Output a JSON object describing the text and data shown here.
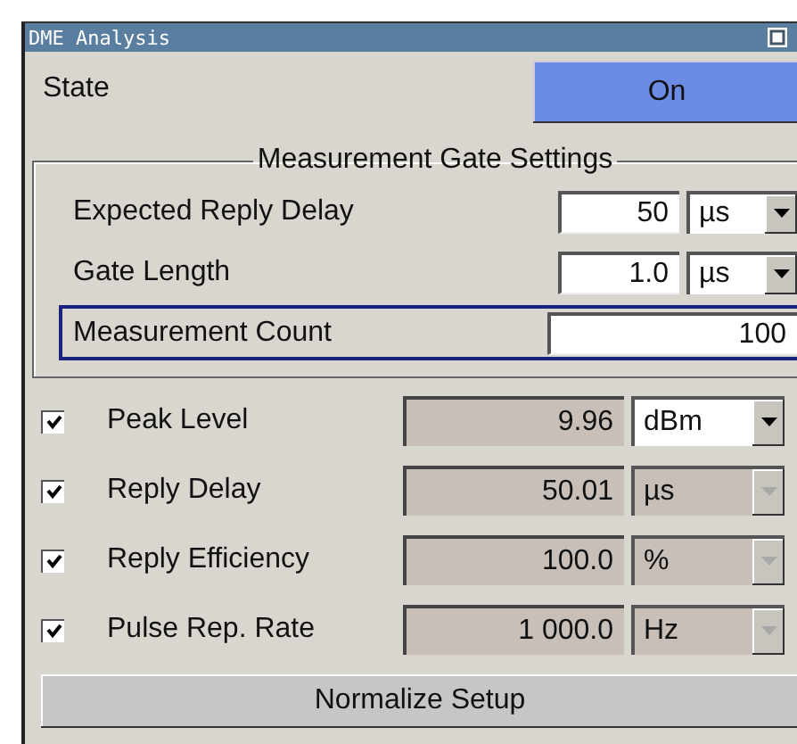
{
  "window": {
    "title": "DME Analysis"
  },
  "state": {
    "label": "State",
    "value": "On",
    "on": true
  },
  "gate": {
    "title": "Measurement Gate Settings",
    "rows": [
      {
        "label": "Expected Reply Delay",
        "value": "50",
        "unit": "µs",
        "focused": false
      },
      {
        "label": "Gate Length",
        "value": "1.0",
        "unit": "µs",
        "focused": false
      },
      {
        "label": "Measurement Count",
        "value": "100",
        "focused": true
      }
    ]
  },
  "measurements": [
    {
      "label": "Peak Level",
      "checked": true,
      "value": "9.96",
      "unit": "dBm",
      "disabled": false
    },
    {
      "label": "Reply Delay",
      "checked": true,
      "value": "50.01",
      "unit": "µs",
      "disabled": true
    },
    {
      "label": "Reply Efficiency",
      "checked": true,
      "value": "100.0",
      "unit": "%",
      "disabled": true
    },
    {
      "label": "Pulse Rep. Rate",
      "checked": true,
      "value": "1 000.0",
      "unit": "Hz",
      "disabled": true
    }
  ],
  "buttons": [
    "Normalize Setup"
  ]
}
